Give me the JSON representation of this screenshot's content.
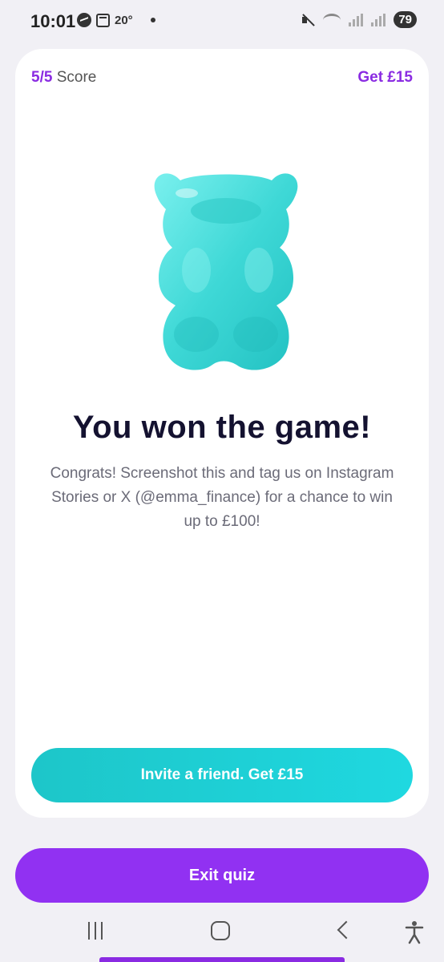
{
  "status_bar": {
    "time": "10:01",
    "temperature": "20°",
    "battery": "79"
  },
  "card": {
    "score_value": "5/5",
    "score_label": " Score",
    "get_reward": "Get £15",
    "headline": "You won the game!",
    "subtext": "Congrats! Screenshot this and tag us on Instagram Stories or X (@emma_finance) for a chance to win up to £100!",
    "invite_button": "Invite a friend. Get £15"
  },
  "exit_button": "Exit quiz",
  "colors": {
    "accent_purple": "#9131f2",
    "accent_teal": "#1fd8e0",
    "bear": "#3ed8d6"
  },
  "icons": {
    "illustration": "gummy-bear-icon",
    "nav_recent": "recent-apps-icon",
    "nav_home": "home-icon",
    "nav_back": "back-icon",
    "nav_accessibility": "accessibility-icon"
  }
}
